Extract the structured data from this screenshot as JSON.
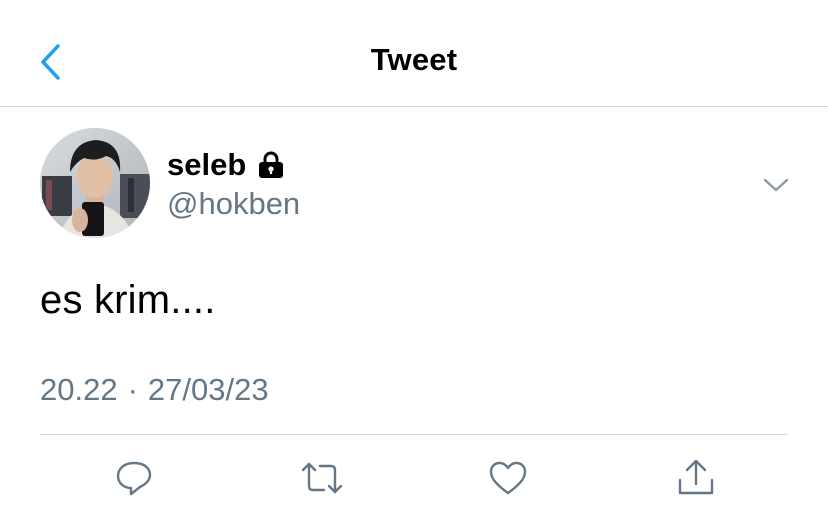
{
  "header": {
    "title": "Tweet",
    "back_icon": "chevron-left-icon",
    "accent_color": "#1da1f2"
  },
  "author": {
    "display_name": "seleb",
    "handle": "@hokben",
    "protected_icon": "lock-icon",
    "menu_icon": "chevron-down-icon"
  },
  "tweet": {
    "text": "es krim....",
    "time": "20.22",
    "separator": "·",
    "date": "27/03/23"
  },
  "actions": [
    {
      "name": "reply",
      "icon": "reply-icon"
    },
    {
      "name": "retweet",
      "icon": "retweet-icon"
    },
    {
      "name": "like",
      "icon": "heart-icon"
    },
    {
      "name": "share",
      "icon": "share-icon"
    }
  ],
  "colors": {
    "text": "#000000",
    "secondary": "#657786",
    "divider": "#d3d8dc",
    "icon": "#657786"
  }
}
